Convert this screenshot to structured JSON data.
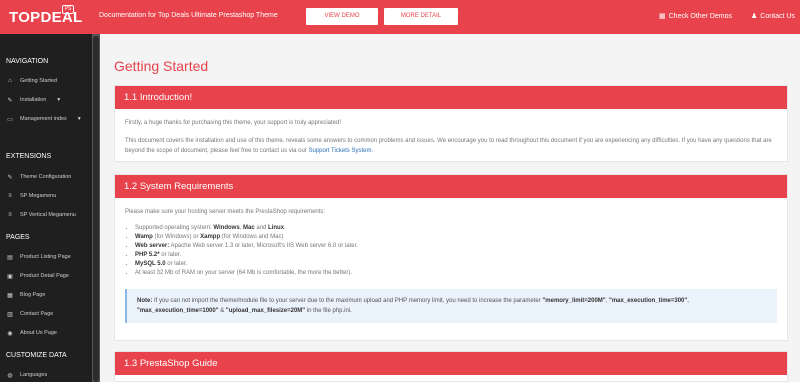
{
  "header": {
    "logo": "TOPDEAL",
    "logo_badge": "PS",
    "doc_title": "Documentation for Top Deals Ultimate Prestashop Theme",
    "view_demo": "VIEW DEMO",
    "more_detail": "MORE DETAIL",
    "check_demos": "Check Other Demos",
    "contact": "Contact Us"
  },
  "sidebar": {
    "navigation_title": "NAVIGATION",
    "navigation": [
      {
        "label": "Getting Started",
        "icon": "home-icon"
      },
      {
        "label": "Installation",
        "icon": "wrench-icon"
      },
      {
        "label": "Management index",
        "icon": "monitor-icon"
      }
    ],
    "extensions_title": "EXTENSIONS",
    "extensions": [
      {
        "label": "Theme Configuration",
        "icon": "pencil-icon"
      },
      {
        "label": "SP Megamenu",
        "icon": "menu-icon"
      },
      {
        "label": "SP Vertical Megamenu",
        "icon": "menu-icon"
      }
    ],
    "pages_title": "PAGES",
    "pages": [
      {
        "label": "Product Listing Page",
        "icon": "list-icon"
      },
      {
        "label": "Product Detail Page",
        "icon": "file-icon"
      },
      {
        "label": "Blog Page",
        "icon": "blog-icon"
      },
      {
        "label": "Contact Page",
        "icon": "contact-icon"
      },
      {
        "label": "About Us Page",
        "icon": "user-icon"
      }
    ],
    "customize_title": "CUSTOMIZE DATA",
    "customize": [
      {
        "label": "Languages",
        "icon": "globe-icon"
      }
    ]
  },
  "main": {
    "page_title": "Getting Started",
    "intro": {
      "title": "1.1 Introduction!",
      "p1": "Firstly, a huge thanks for purchasing this theme, your support is truly appreciated!",
      "p2": "This document covers the installation and use of this theme, reveals some answers to common problems and issues. We encourage you to read throughout this document if you are experiencing any difficulties. If you have any questions that are beyond the scope of document, please feel free to contact us via our",
      "link": "Support Tickets System",
      "p2_end": "."
    },
    "requirements": {
      "title": "1.2 System Requirements",
      "lead": "Please make sure your hosting server meets the PrestaShop requirements:",
      "item1_pre": "Supported operating system: ",
      "item1_os1": "Windows",
      "item1_sep1": ", ",
      "item1_os2": "Mac",
      "item1_and": " and ",
      "item1_os3": "Linux",
      "item1_end": ".",
      "item2_a": "Wamp",
      "item2_b": " (for Windows) or ",
      "item2_c": "Xampp",
      "item2_d": " (for Windows and Mac)",
      "item3_a": "Web server:",
      "item3_b": " Apache Web server 1.3 or later, Microsoft's IIS Web server 6.0 or later.",
      "item4_a": "PHP 5.2*",
      "item4_b": " or later.",
      "item5_a": "MySQL 5.0",
      "item5_b": " or later.",
      "item6": "At least 32 Mb of RAM on your server (64 Mb is comfortable, the more the better).",
      "note_label": "Note:",
      "note_text": " If you can not import the theme/module file to your server due to the maximum upload and PHP memory limit, you need to increase the parameter ",
      "code1": "\"memory_limit=200M\"",
      "code_sep1": ", ",
      "code2": "\"max_execution_time=300\"",
      "code_sep2": ", ",
      "code3": "\"max_execution_time=1000\"",
      "code_and": " & ",
      "code4": "\"upload_max_filesize=20M\"",
      "note_end": " in the file php.ini."
    },
    "guide": {
      "title": "1.3 PrestaShop Guide"
    }
  }
}
